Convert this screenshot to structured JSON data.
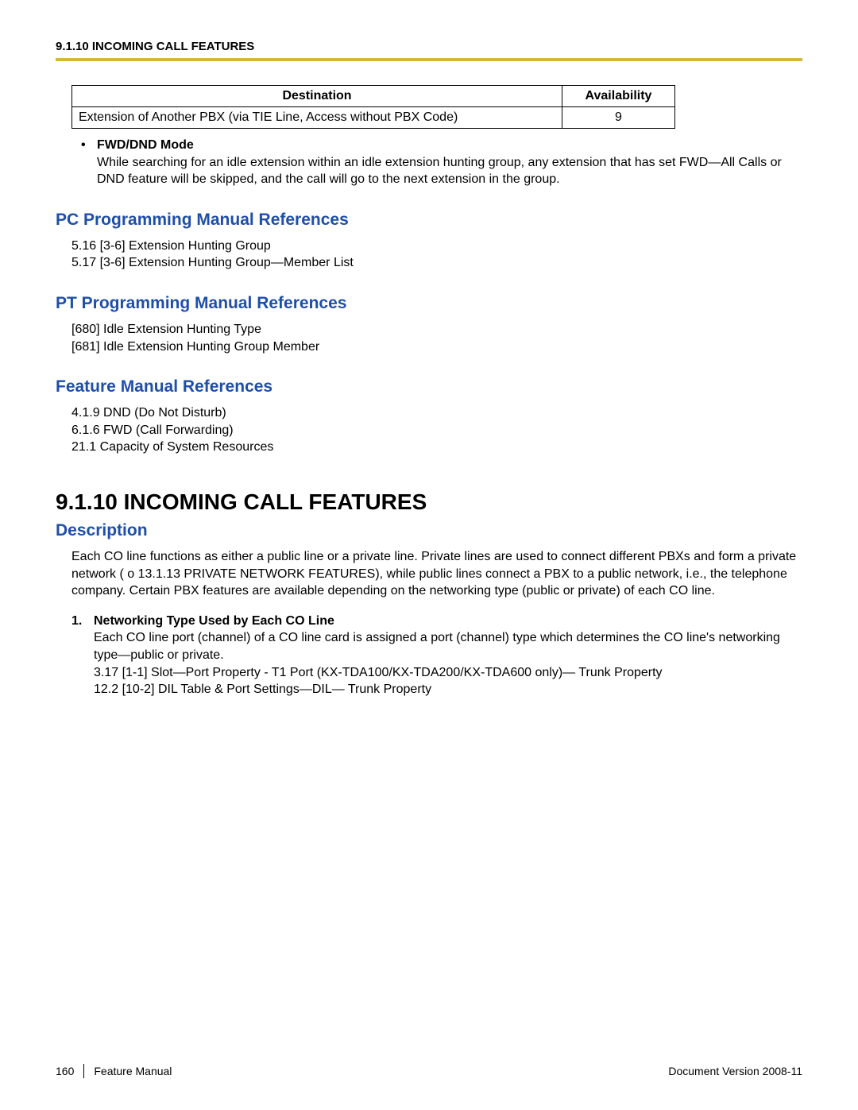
{
  "header": "9.1.10 INCOMING CALL FEATURES",
  "table": {
    "h1": "Destination",
    "h2": "Availability",
    "row1_dest": "Extension of Another PBX (via TIE Line, Access without PBX Code)",
    "row1_avail": "9"
  },
  "bullet1": {
    "dot": "•",
    "title": "FWD/DND Mode",
    "body": "While searching for an idle extension within an idle extension hunting group, any extension that has set FWD—All Calls or DND feature will be skipped, and the call will go to the next extension in the group."
  },
  "pc_heading": "PC Programming Manual References",
  "pc_refs": "5.16  [3-6] Extension Hunting Group\n5.17  [3-6] Extension Hunting Group—Member List",
  "pt_heading": "PT Programming Manual References",
  "pt_refs": "[680] Idle Extension Hunting Type\n[681] Idle Extension Hunting Group Member",
  "fm_heading": "Feature Manual References",
  "fm_refs": "4.1.9  DND (Do Not Disturb)\n6.1.6  FWD (Call Forwarding)\n21.1  Capacity of System Resources",
  "main_heading": "9.1.10  INCOMING CALL FEATURES",
  "desc_heading": "Description",
  "desc_body": "Each CO line functions as either a public line or a private line. Private lines are used to connect different PBXs and form a private network ( o 13.1.13  PRIVATE NETWORK FEATURES), while public lines connect a PBX to a public network, i.e., the telephone company. Certain PBX features are available depending on the networking type (public or private) of each CO line.",
  "item1": {
    "num": "1.",
    "title": "Networking Type Used by Each CO Line",
    "body": "Each CO line port (channel) of a CO line card is assigned a port (channel) type which determines the CO line's networking type—public or private.\n3.17  [1-1] Slot—Port Property - T1 Port (KX-TDA100/KX-TDA200/KX-TDA600 only)—     Trunk Property\n12.2  [10-2] DIL Table & Port Settings—DIL—     Trunk Property"
  },
  "footer": {
    "page": "160",
    "left": "Feature Manual",
    "right": "Document Version  2008-11"
  }
}
